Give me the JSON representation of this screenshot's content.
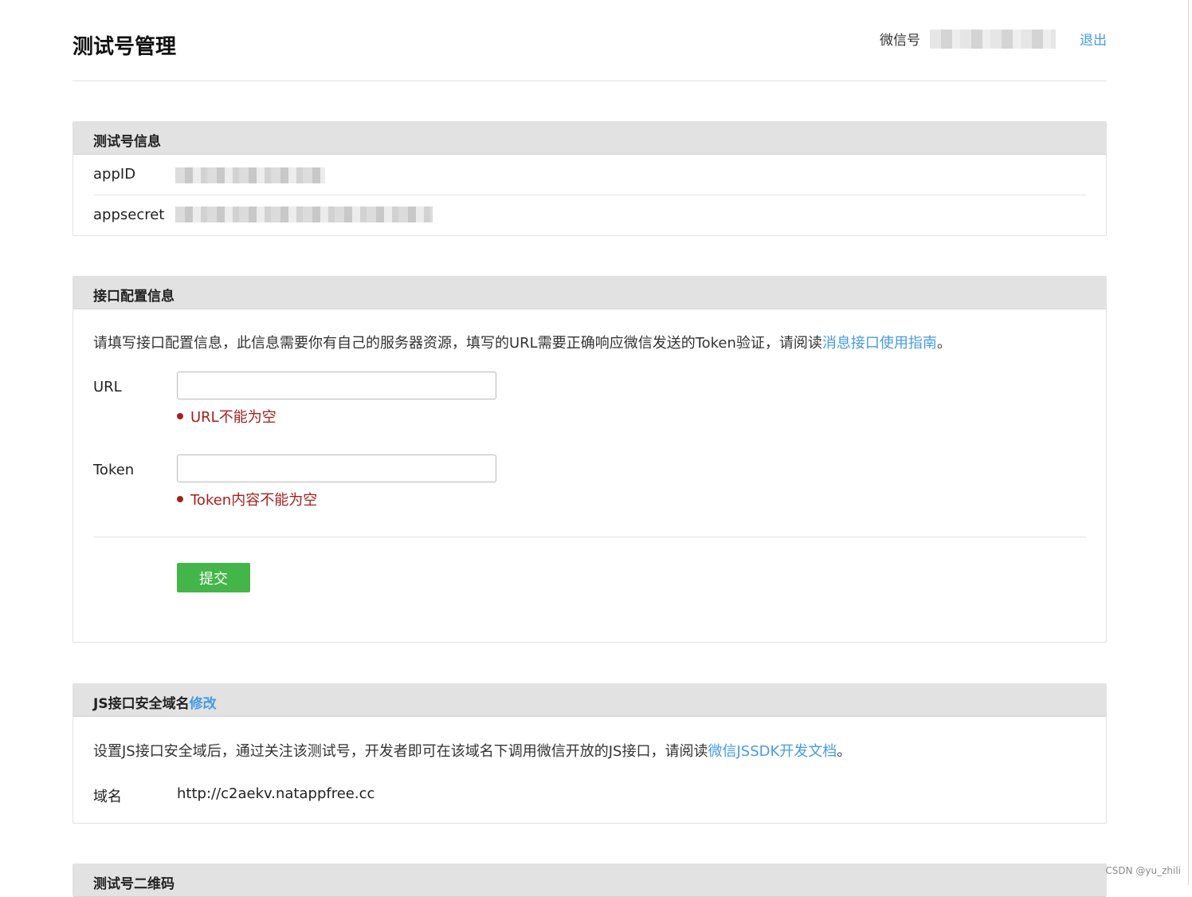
{
  "header": {
    "title": "测试号管理",
    "wechat_label": "微信号",
    "wechat_value": "gh_xxxxxxxxxx56",
    "logout": "退出"
  },
  "test_account": {
    "title": "测试号信息",
    "appid_label": "appID",
    "appid_value": "wx9c53a1c03xxxxxxx",
    "appsecret_label": "appsecret",
    "appsecret_value": "xxxxxxxxxxxxxxxxxxxxxxxxxxxxxxxb"
  },
  "interface_config": {
    "title": "接口配置信息",
    "description": "请填写接口配置信息，此信息需要你有自己的服务器资源，填写的URL需要正确响应微信发送的Token验证，请阅读",
    "description_link": "消息接口使用指南",
    "description_end": "。",
    "url_label": "URL",
    "url_value": "",
    "url_error": "URL不能为空",
    "token_label": "Token",
    "token_value": "",
    "token_error": "Token内容不能为空",
    "submit": "提交"
  },
  "js_domain": {
    "title": "JS接口安全域名",
    "edit_link": "修改",
    "description": "设置JS接口安全域后，通过关注该测试号，开发者即可在该域名下调用微信开放的JS接口，请阅读",
    "description_link": "微信JSSDK开发文档",
    "description_end": "。",
    "domain_label": "域名",
    "domain_value": "http://c2aekv.natappfree.cc"
  },
  "qr_code": {
    "title": "测试号二维码"
  },
  "watermark": "CSDN @yu_zhili",
  "colors": {
    "link": "#459ae9",
    "error": "#a51f1f",
    "submit_bg": "#44b549",
    "panel_header_bg": "#e2e2e2"
  }
}
